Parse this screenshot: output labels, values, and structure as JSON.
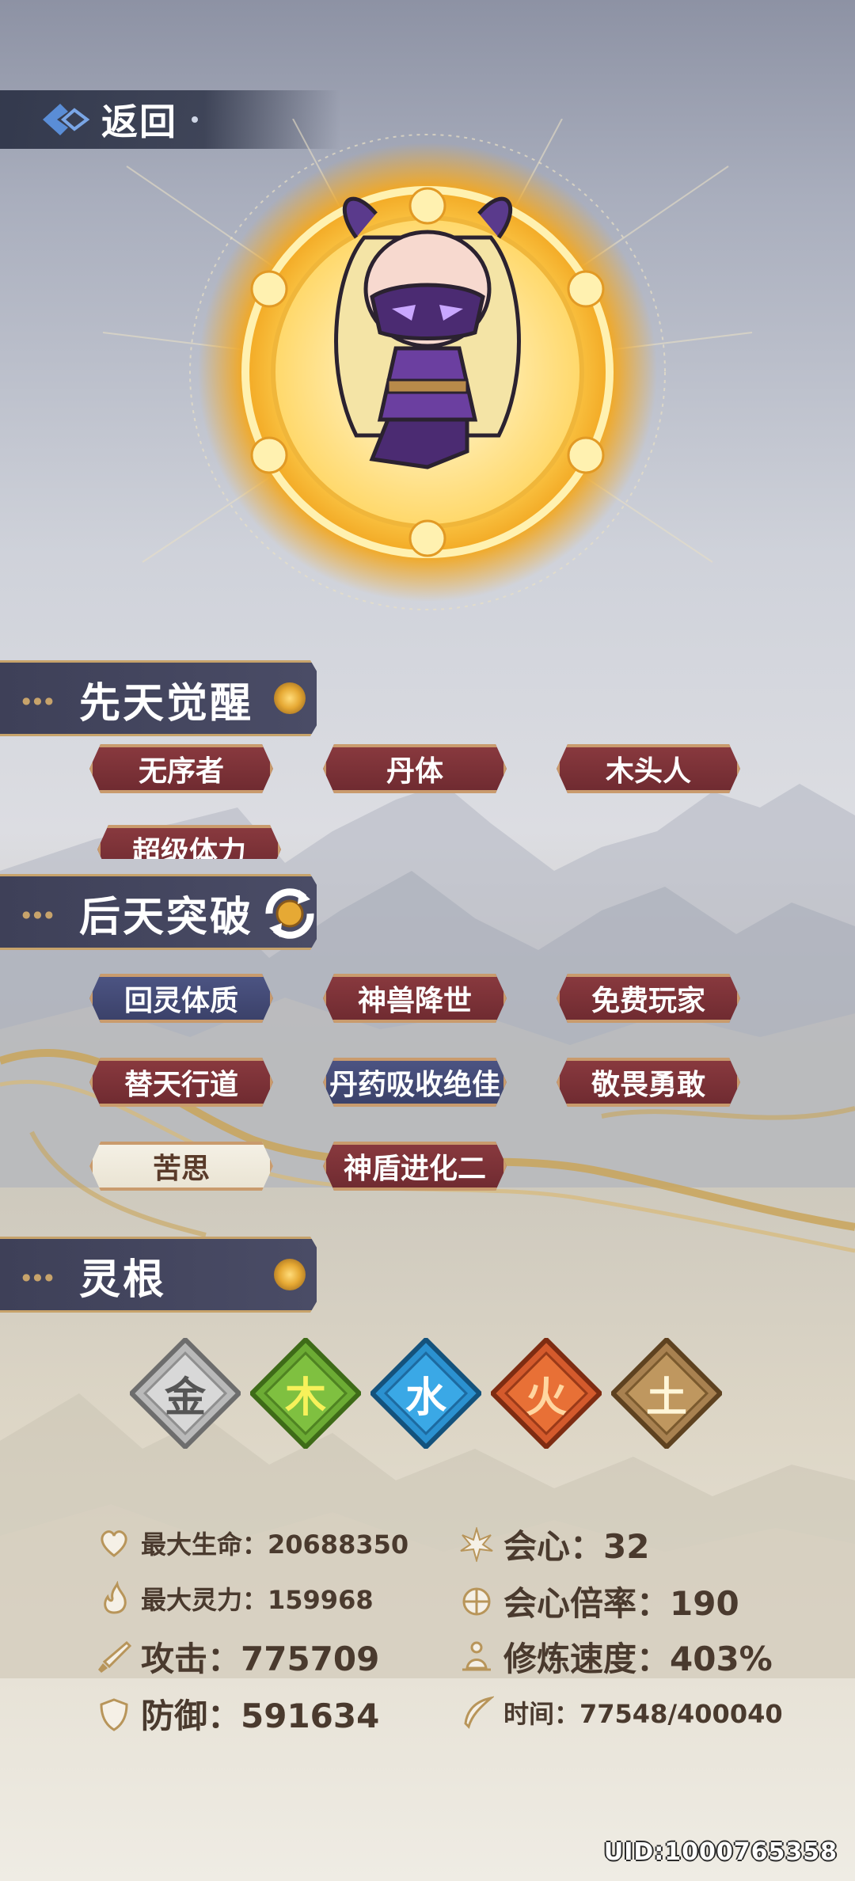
{
  "header": {
    "back_label": "返回"
  },
  "sections": {
    "innate": {
      "title": "先天觉醒",
      "tags": [
        {
          "label": "无序者",
          "style": "red"
        },
        {
          "label": "丹体",
          "style": "red"
        },
        {
          "label": "木头人",
          "style": "red"
        },
        {
          "label": "超级体力",
          "style": "red"
        }
      ]
    },
    "acquired": {
      "title": "后天突破",
      "tags": [
        {
          "label": "回灵体质",
          "style": "blue"
        },
        {
          "label": "神兽降世",
          "style": "red"
        },
        {
          "label": "免费玩家",
          "style": "red"
        },
        {
          "label": "替天行道",
          "style": "red"
        },
        {
          "label": "丹药吸收绝佳",
          "style": "blue"
        },
        {
          "label": "敬畏勇敢",
          "style": "red"
        },
        {
          "label": "苦思",
          "style": "cream"
        },
        {
          "label": "神盾进化二",
          "style": "red"
        }
      ]
    },
    "spirit_root": {
      "title": "灵根",
      "elements": [
        {
          "glyph": "金",
          "name": "metal",
          "color": "#9a9a9a"
        },
        {
          "glyph": "木",
          "name": "wood",
          "color": "#5e9a2c"
        },
        {
          "glyph": "水",
          "name": "water",
          "color": "#2a8ec9"
        },
        {
          "glyph": "火",
          "name": "fire",
          "color": "#d2562a"
        },
        {
          "glyph": "土",
          "name": "earth",
          "color": "#a07a44"
        }
      ]
    }
  },
  "stats": {
    "max_hp": "最大生命：20688350",
    "crit": "会心：32",
    "max_mana": "最大灵力：159968",
    "crit_rate": "会心倍率：190",
    "attack": "攻击：775709",
    "cultivation_speed": "修炼速度：403%",
    "defense": "防御：591634",
    "time": "时间：77548/400040"
  },
  "uid": "UID:1000765358"
}
